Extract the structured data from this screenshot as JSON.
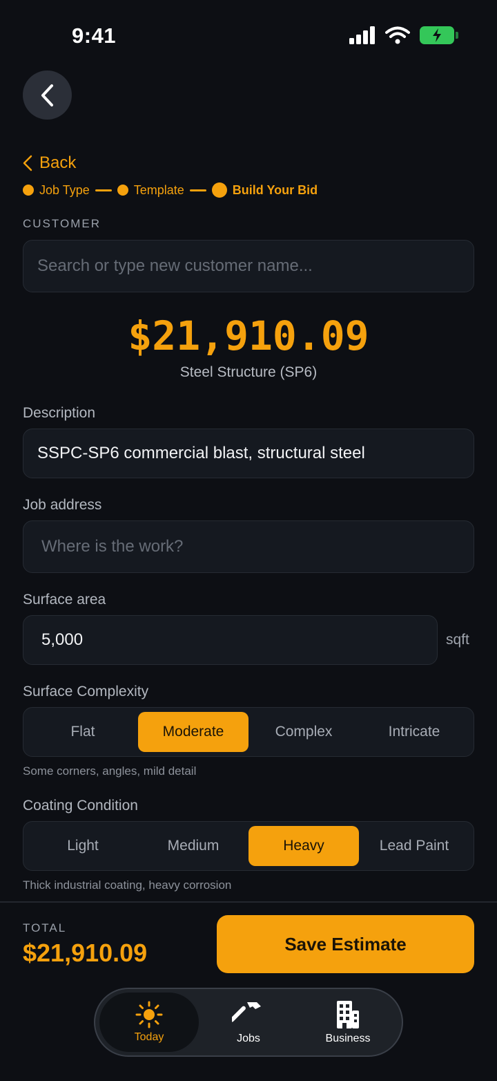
{
  "status": {
    "time": "9:41"
  },
  "nav": {
    "back_label": "Back"
  },
  "stepper": {
    "steps": [
      "Job Type",
      "Template",
      "Build Your Bid"
    ]
  },
  "customer": {
    "section_label": "CUSTOMER",
    "placeholder": "Search or type new customer name..."
  },
  "summary": {
    "price": "$21,910.09",
    "subtitle": "Steel Structure (SP6)"
  },
  "form": {
    "description_label": "Description",
    "description_value": "SSPC-SP6 commercial blast, structural steel",
    "address_label": "Job address",
    "address_placeholder": "Where is the work?",
    "area_label": "Surface area",
    "area_value": "5,000",
    "area_unit": "sqft"
  },
  "complexity": {
    "label": "Surface Complexity",
    "options": [
      "Flat",
      "Moderate",
      "Complex",
      "Intricate"
    ],
    "selected": "Moderate",
    "hint": "Some corners, angles, mild detail"
  },
  "condition": {
    "label": "Coating Condition",
    "options": [
      "Light",
      "Medium",
      "Heavy",
      "Lead Paint"
    ],
    "selected": "Heavy",
    "hint": "Thick industrial coating, heavy corrosion"
  },
  "footer": {
    "total_label": "TOTAL",
    "total_value": "$21,910.09",
    "save_label": "Save Estimate"
  },
  "tabs": [
    {
      "label": "Today",
      "icon": "sun-icon",
      "active": true
    },
    {
      "label": "Jobs",
      "icon": "hammer-icon",
      "active": false
    },
    {
      "label": "Business",
      "icon": "building-icon",
      "active": false
    }
  ],
  "colors": {
    "accent": "#f5a10d",
    "background": "#0d0f14",
    "battery": "#34c759"
  }
}
